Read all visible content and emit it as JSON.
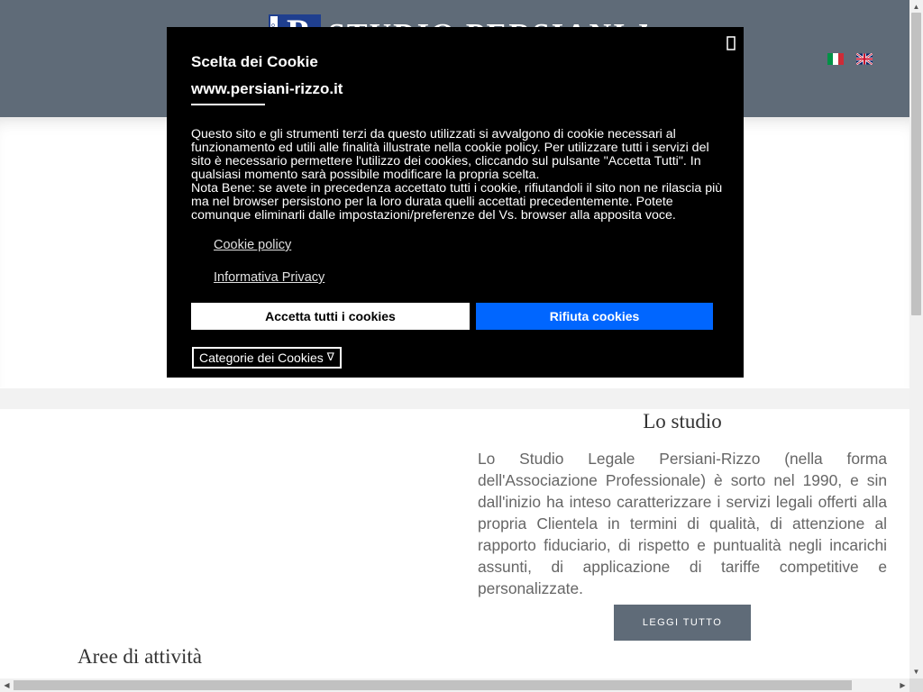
{
  "header": {
    "logo_letter": "P",
    "logo_vertical_text": "Studio Legale",
    "logo_name": "STUDIO PERSIANI-RIZZO",
    "languages": [
      {
        "code": "it",
        "icon": "italian-flag-icon"
      },
      {
        "code": "en",
        "icon": "uk-flag-icon"
      }
    ]
  },
  "cookie_banner": {
    "close_glyph": "",
    "title": "Scelta dei Cookie",
    "site": "www.persiani-rizzo.it",
    "body_paragraph_1": "Questo sito e gli strumenti terzi da questo utilizzati si avvalgono di cookie necessari al funzionamento ed utili alle finalità illustrate nella cookie policy. Per utilizzare tutti i servizi del sito è necessario permettere l'utilizzo dei cookies, cliccando sul pulsante \"Accetta Tutti\". In qualsiasi momento sarà possibile modificare la propria scelta.",
    "body_paragraph_2": "Nota Bene: se avete in precedenza accettato tutti i cookie, rifiutandoli il sito non ne rilascia più ma nel browser persistono per la loro durata quelli accettati precedentemente. Potete comunque eliminarli dalle impostazioni/preferenze del Vs. browser alla apposita voce.",
    "cookie_policy_link": "Cookie policy",
    "privacy_link": "Informativa Privacy",
    "accept_label": "Accetta tutti i cookies",
    "reject_label": "Rifiuta cookies",
    "categories_label": "Categorie dei Cookies",
    "categories_chevron": "∇"
  },
  "studio": {
    "title": "Lo studio",
    "text": "Lo Studio Legale Persiani-Rizzo (nella forma dell'Associazione Professionale) è sorto nel 1990, e sin dall'inizio ha inteso caratterizzare i servizi legali offerti alla propria Clientela in termini di qualità, di attenzione al rapporto fiduciario, di rispetto e puntualità negli incarichi assunti, di applicazione di tariffe competitive e personalizzate.",
    "button_label": "LEGGI TUTTO"
  },
  "areas": {
    "title": "Aree di attività"
  },
  "colors": {
    "header_bg": "#5f6b78",
    "reject_button": "#0066ff",
    "modal_bg": "#000000"
  }
}
